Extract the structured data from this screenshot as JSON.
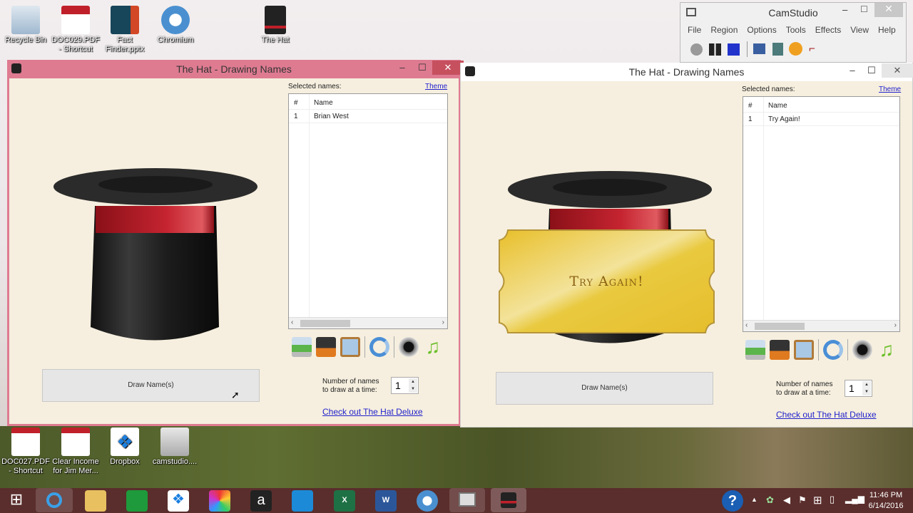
{
  "desktop": {
    "icons_top": [
      {
        "label": "Recycle Bin",
        "icon": "recycle-bin-icon"
      },
      {
        "label": "DOC029.PDF - Shortcut",
        "icon": "pdf-icon"
      },
      {
        "label": "Fact Finder.pptx",
        "icon": "powerpoint-icon"
      },
      {
        "label": "Chromium",
        "icon": "chromium-icon"
      },
      {
        "label": "The Hat",
        "icon": "hat-icon"
      }
    ],
    "icons_bottom": [
      {
        "label": "DOC027.PDF - Shortcut",
        "icon": "pdf-icon"
      },
      {
        "label": "Clear Income for Jim Mer...",
        "icon": "pdf-icon"
      },
      {
        "label": "Dropbox",
        "icon": "dropbox-icon"
      },
      {
        "label": "camstudio....",
        "icon": "installer-icon"
      }
    ]
  },
  "camstudio": {
    "title": "CamStudio",
    "menu": [
      "File",
      "Region",
      "Options",
      "Tools",
      "Effects",
      "View",
      "Help"
    ]
  },
  "window_left": {
    "title": "The Hat - Drawing Names",
    "selected_label": "Selected names:",
    "theme_link": "Theme",
    "col_num": "#",
    "col_name": "Name",
    "rows": [
      {
        "num": "1",
        "name": "Brian West"
      }
    ],
    "draw_button": "Draw Name(s)",
    "count_label_1": "Number of names",
    "count_label_2": "to draw at a time:",
    "count_value": "1",
    "deluxe_link": "Check out The Hat Deluxe",
    "active": true
  },
  "window_right": {
    "title": "The Hat - Drawing Names",
    "selected_label": "Selected names:",
    "theme_link": "Theme",
    "col_num": "#",
    "col_name": "Name",
    "rows": [
      {
        "num": "1",
        "name": "Try Again!"
      }
    ],
    "ticket_text": "Try Again!",
    "draw_button": "Draw Name(s)",
    "count_label_1": "Number of names",
    "count_label_2": "to draw at a time:",
    "count_value": "1",
    "deluxe_link": "Check out The Hat Deluxe",
    "active": false
  },
  "toolbar_icons": [
    "print-icon",
    "save-icon",
    "clipboard-icon",
    "refresh-icon",
    "speaker-icon",
    "music-icon"
  ],
  "taskbar": {
    "time": "11:46 PM",
    "date": "6/14/2016",
    "apps": [
      "start",
      "internet-explorer",
      "file-explorer",
      "store",
      "dropbox",
      "photos",
      "amazon",
      "onedrive",
      "excel",
      "word",
      "chromium",
      "camstudio",
      "the-hat"
    ]
  },
  "colors": {
    "active_frame": "#de7b91",
    "client_bg": "#f6efdf",
    "ticket": "#e9c53a",
    "hat_band": "#c0202a"
  }
}
